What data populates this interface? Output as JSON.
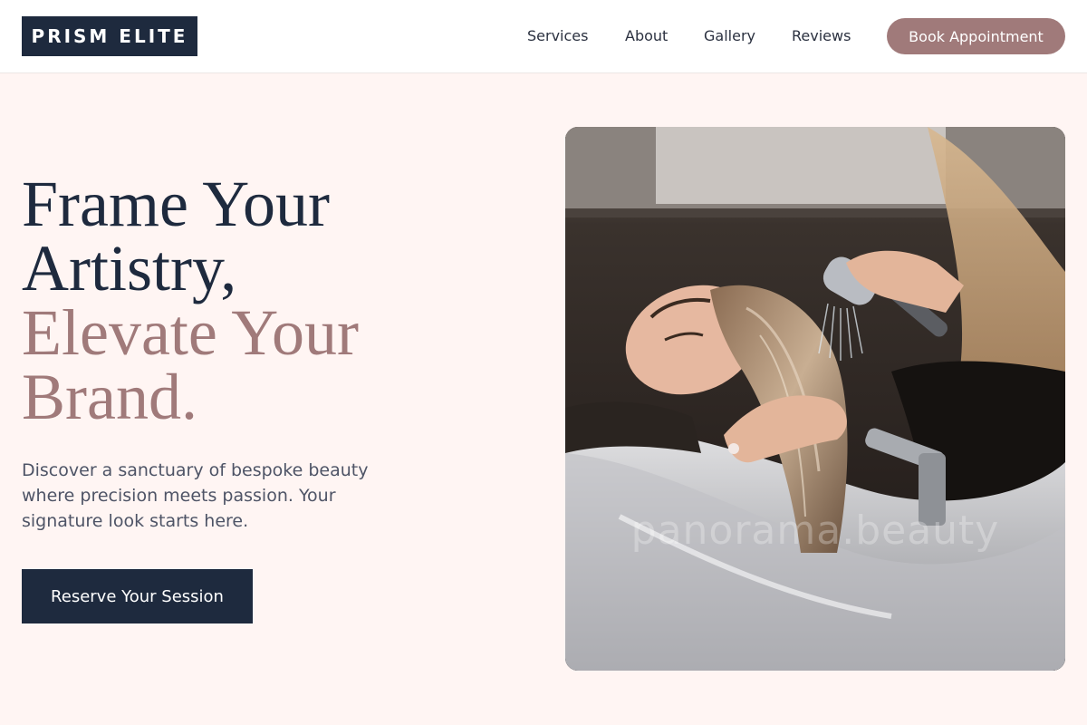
{
  "brand": {
    "name": "PRISM ELITE"
  },
  "nav": {
    "items": [
      {
        "label": "Services"
      },
      {
        "label": "About"
      },
      {
        "label": "Gallery"
      },
      {
        "label": "Reviews"
      }
    ],
    "cta_label": "Book Appointment"
  },
  "hero": {
    "title_line1": "Frame Your",
    "title_line2": "Artistry,",
    "title_line3": "Elevate Your",
    "title_line4": "Brand.",
    "description": "Discover a sanctuary of bespoke beauty where precision meets passion. Your signature look starts here.",
    "cta_label": "Reserve Your Session",
    "image_watermark": "panorama.beauty"
  },
  "colors": {
    "navy": "#1e2a3e",
    "accent": "#a07a7a",
    "background": "#fff5f3"
  }
}
